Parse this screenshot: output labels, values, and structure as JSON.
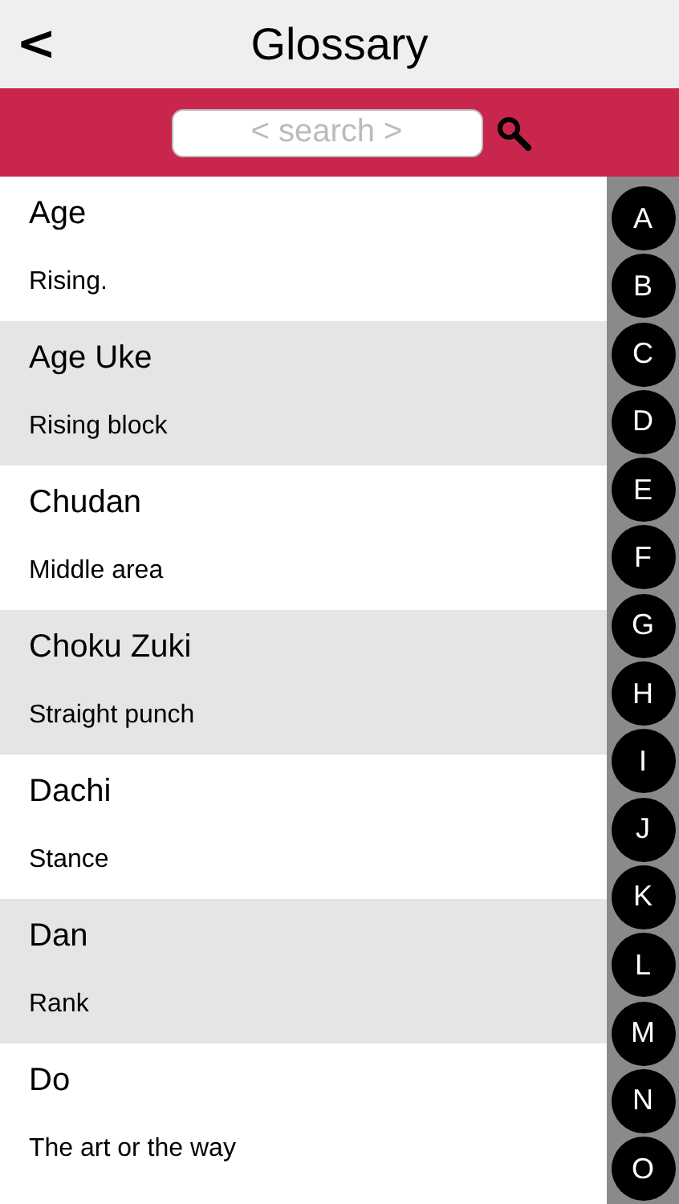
{
  "header": {
    "back": "<",
    "title": "Glossary"
  },
  "search": {
    "placeholder": "< search >"
  },
  "entries": [
    {
      "term": "Age",
      "meaning": "Rising."
    },
    {
      "term": "Age Uke",
      "meaning": "Rising block"
    },
    {
      "term": "Chudan",
      "meaning": "Middle area"
    },
    {
      "term": "Choku Zuki",
      "meaning": "Straight punch"
    },
    {
      "term": "Dachi",
      "meaning": "Stance"
    },
    {
      "term": "Dan",
      "meaning": "Rank"
    },
    {
      "term": "Do",
      "meaning": "The art or the way"
    }
  ],
  "index": [
    "A",
    "B",
    "C",
    "D",
    "E",
    "F",
    "G",
    "H",
    "I",
    "J",
    "K",
    "L",
    "M",
    "N",
    "O"
  ]
}
